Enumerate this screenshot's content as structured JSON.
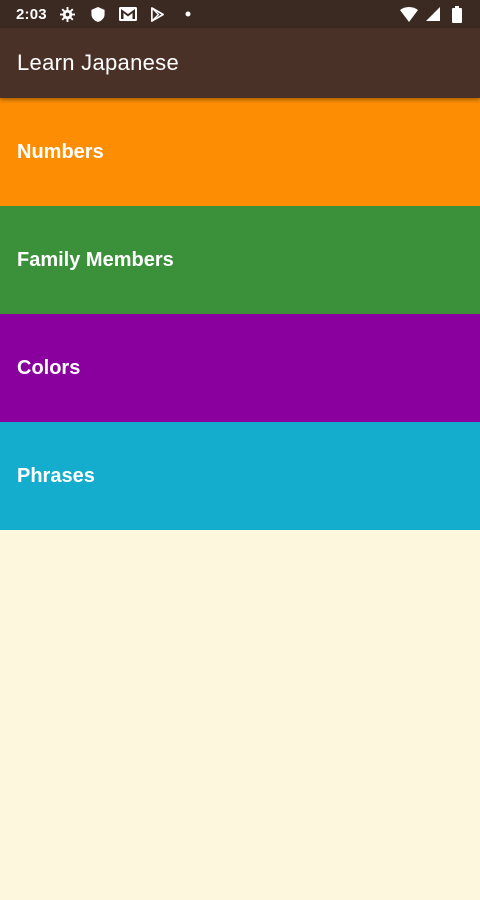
{
  "status_bar": {
    "time": "2:03",
    "left_icons": [
      "gear-icon",
      "shield-icon",
      "gmail-icon",
      "play-store-icon",
      "dot-icon"
    ],
    "right_icons": [
      "wifi-icon",
      "signal-icon",
      "battery-icon"
    ]
  },
  "app_bar": {
    "title": "Learn Japanese"
  },
  "categories": [
    {
      "label": "Numbers",
      "color": "#fd8e04"
    },
    {
      "label": "Family Members",
      "color": "#3a913a"
    },
    {
      "label": "Colors",
      "color": "#8a009e"
    },
    {
      "label": "Phrases",
      "color": "#15adce"
    }
  ],
  "colors": {
    "status_bar": "#3b2a22",
    "app_bar": "#4a3128",
    "background": "#fdf7dd"
  }
}
